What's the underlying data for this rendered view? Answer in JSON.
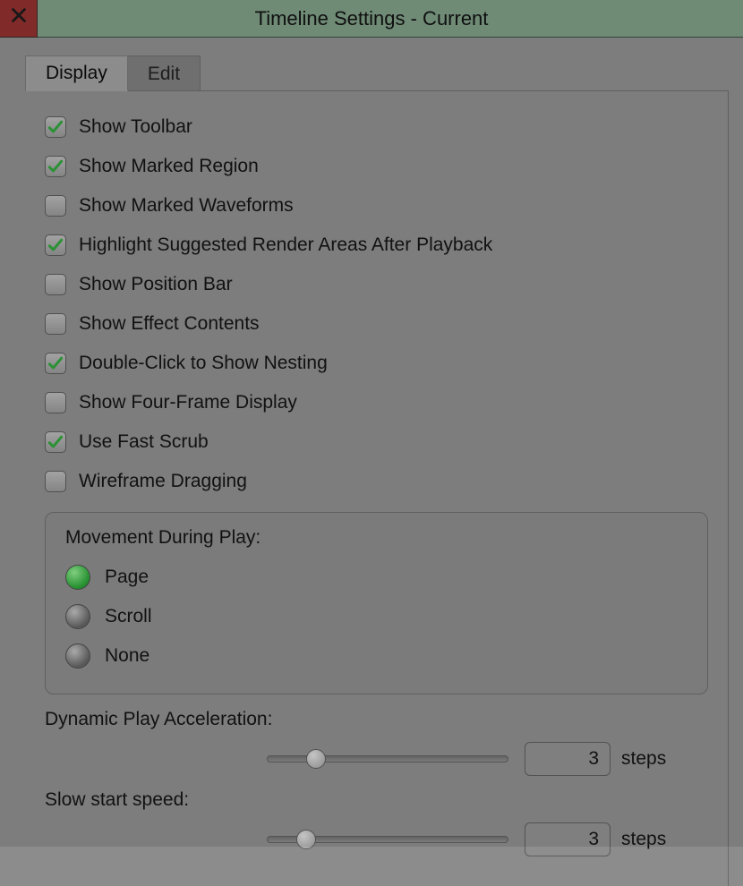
{
  "window": {
    "title": "Timeline Settings - Current",
    "close_icon": "close-icon"
  },
  "tabs": [
    {
      "label": "Display",
      "active": true
    },
    {
      "label": "Edit",
      "active": false
    }
  ],
  "checkboxes": [
    {
      "label": "Show Toolbar",
      "checked": true
    },
    {
      "label": "Show Marked Region",
      "checked": true
    },
    {
      "label": "Show Marked Waveforms",
      "checked": false
    },
    {
      "label": "Highlight Suggested Render Areas After Playback",
      "checked": true
    },
    {
      "label": "Show Position Bar",
      "checked": false
    },
    {
      "label": "Show Effect Contents",
      "checked": false
    },
    {
      "label": "Double-Click to Show Nesting",
      "checked": true
    },
    {
      "label": "Show Four-Frame Display",
      "checked": false
    },
    {
      "label": "Use Fast Scrub",
      "checked": true
    },
    {
      "label": "Wireframe Dragging",
      "checked": false
    }
  ],
  "movement_group": {
    "title": "Movement During Play:",
    "options": [
      {
        "label": "Page",
        "selected": true
      },
      {
        "label": "Scroll",
        "selected": false
      },
      {
        "label": "None",
        "selected": false
      }
    ]
  },
  "dynamic_accel": {
    "label": "Dynamic Play Acceleration:",
    "value": "3",
    "unit": "steps",
    "thumb_percent": 20
  },
  "slow_start": {
    "label": "Slow start speed:",
    "value": "3",
    "unit": "steps",
    "thumb_percent": 16
  }
}
